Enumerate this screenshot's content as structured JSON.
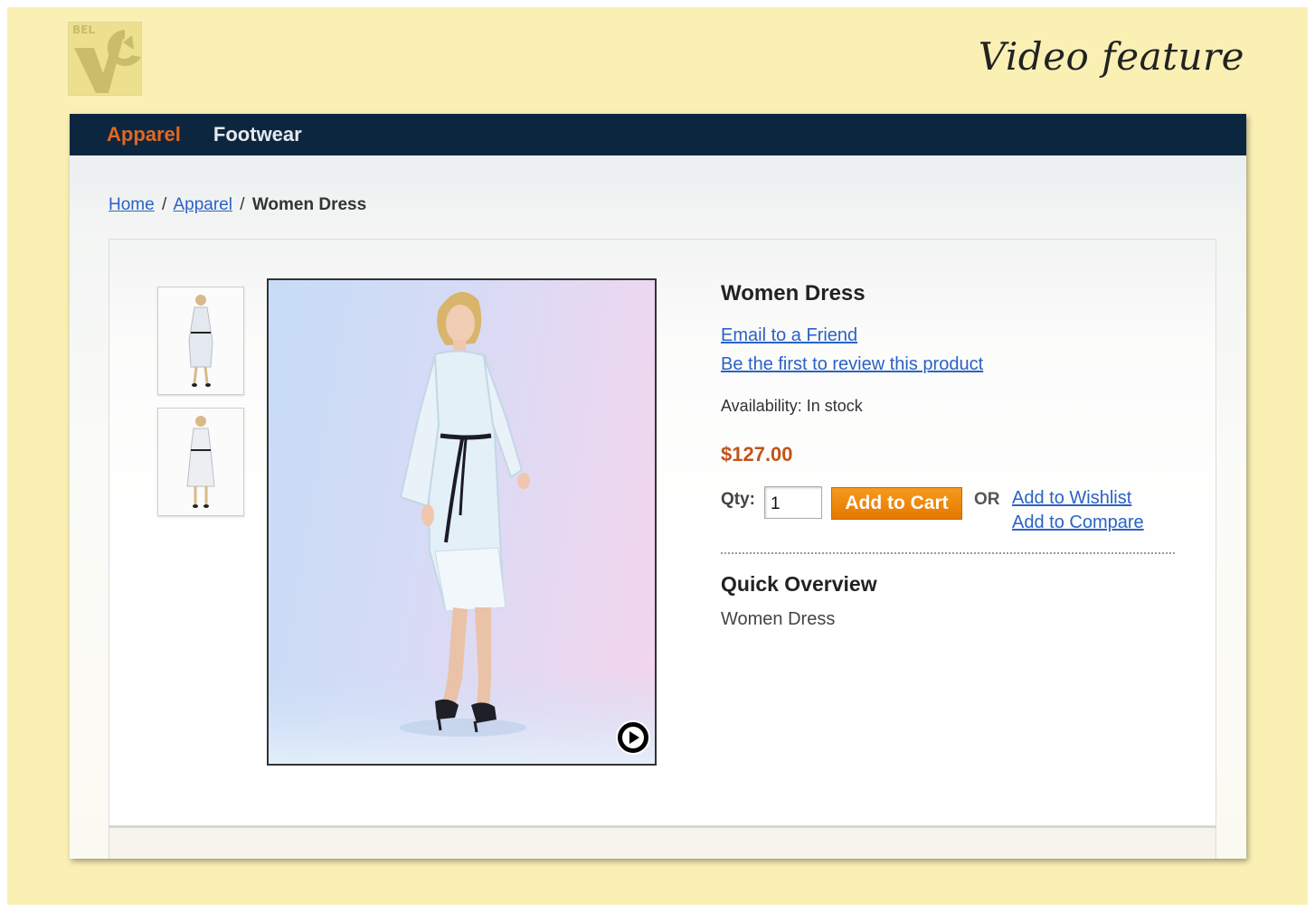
{
  "header": {
    "feature_title": "Video feature",
    "logo_text": "BEL"
  },
  "nav": {
    "items": [
      {
        "label": "Apparel",
        "active": true
      },
      {
        "label": "Footwear",
        "active": false
      }
    ]
  },
  "breadcrumb": {
    "home": "Home",
    "separator": "/",
    "category": "Apparel",
    "current": "Women Dress"
  },
  "product": {
    "name": "Women Dress",
    "email_link": "Email to a Friend",
    "review_link": "Be the first to review this product",
    "availability": "Availability: In stock",
    "price": "$127.00",
    "qty_label": "Qty:",
    "qty_value": "1",
    "add_to_cart": "Add to Cart",
    "or_label": "OR",
    "wishlist_link": "Add to Wishlist",
    "compare_link": "Add to Compare",
    "overview_title": "Quick Overview",
    "overview_text": "Women Dress"
  },
  "media": {
    "thumbnail_count": 2,
    "main_image": "woman-in-white-lace-dress",
    "play_icon": "play-icon"
  },
  "colors": {
    "page_bg": "#faf0b4",
    "nav_bg": "#0c2640",
    "nav_active": "#e26820",
    "link": "#2a62c5",
    "price": "#c2541a",
    "cart_button": "#f08a10"
  }
}
